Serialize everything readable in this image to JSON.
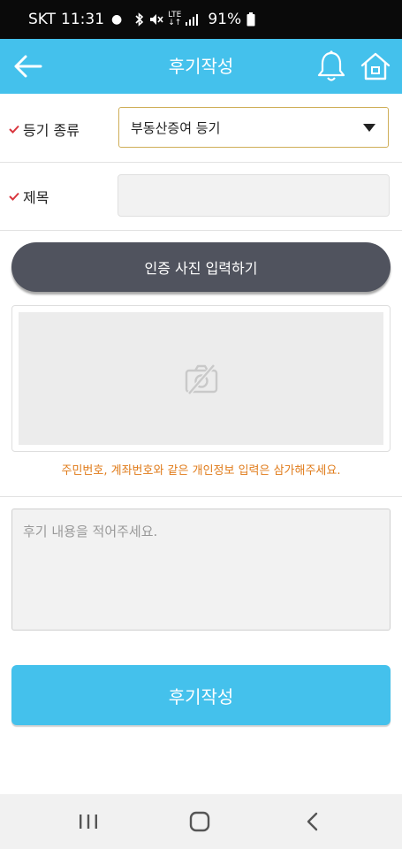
{
  "status_bar": {
    "carrier": "SKT",
    "time": "11:31",
    "network": "LTE",
    "battery": "91%"
  },
  "header": {
    "title": "후기작성",
    "back_icon": "arrow-left-icon",
    "bell_icon": "bell-icon",
    "home_icon": "home-icon"
  },
  "form": {
    "registry_type": {
      "label": "등기 종류",
      "selected": "부동산증여 등기"
    },
    "title_field": {
      "label": "제목",
      "value": ""
    },
    "photo_button_label": "인증 사진 입력하기",
    "privacy_warning": "주민번호, 계좌번호와 같은 개인정보 입력은 삼가해주세요.",
    "content_placeholder": "후기 내용을 적어주세요.",
    "submit_label": "후기작성"
  },
  "colors": {
    "accent": "#44c1ec",
    "photo_button": "#50535e",
    "warning": "#e07b1a",
    "required_check": "#d9363e"
  },
  "navigation_bar": {
    "recent_icon": "recent-apps-icon",
    "home_icon": "android-home-icon",
    "back_icon": "android-back-icon"
  }
}
